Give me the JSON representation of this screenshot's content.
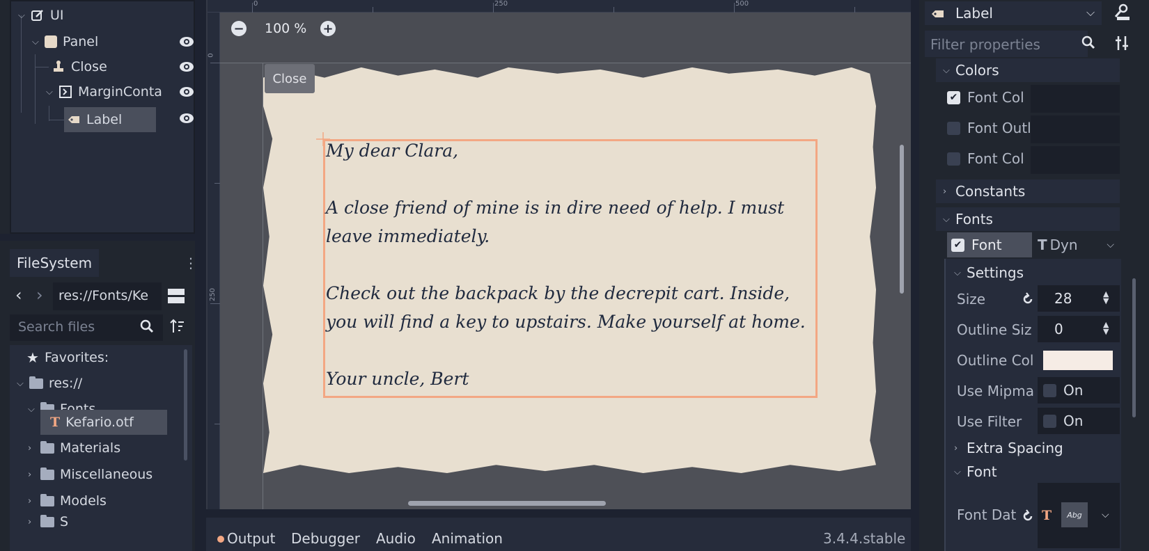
{
  "scene": {
    "root": "UI",
    "nodes": [
      {
        "name": "Panel"
      },
      {
        "name": "Close"
      },
      {
        "name": "MarginConta"
      },
      {
        "name": "Label"
      }
    ]
  },
  "filesystem": {
    "tab": "FileSystem",
    "path": "res://Fonts/Ke",
    "search_placeholder": "Search files",
    "favorites": "Favorites:",
    "items": [
      {
        "label": "res://"
      },
      {
        "label": "Fonts"
      },
      {
        "label": "Kefario.otf"
      },
      {
        "label": "Materials"
      },
      {
        "label": "Miscellaneous"
      },
      {
        "label": "Models"
      },
      {
        "label": "S"
      }
    ]
  },
  "viewport": {
    "zoom": "100 %",
    "ruler_top": [
      "0",
      "250",
      "500"
    ],
    "ruler_left": [
      "0",
      "250"
    ],
    "close_button": "Close",
    "letter_text": "My dear Clara,\n\nA close friend of mine is in dire need of help. I must\nleave immediately.\n\nCheck out the backpack by the decrepit cart. Inside,\nyou will find a key to upstairs. Make yourself at home.\n\nYour uncle, Bert"
  },
  "bottom": {
    "tabs": [
      "Output",
      "Debugger",
      "Audio",
      "Animation"
    ],
    "version": "3.4.4.stable"
  },
  "inspector": {
    "class_name": "Label",
    "filter_placeholder": "Filter properties",
    "colors_section": "Colors",
    "colors": [
      {
        "label": "Font Col",
        "checked": true
      },
      {
        "label": "Font Outl",
        "checked": false
      },
      {
        "label": "Font Col",
        "checked": false
      }
    ],
    "constants_section": "Constants",
    "fonts_section": "Fonts",
    "font_prop": "Font",
    "font_type": "Dyn",
    "settings_section": "Settings",
    "size_label": "Size",
    "size_value": "28",
    "outline_size_label": "Outline Siz",
    "outline_size_value": "0",
    "outline_color_label": "Outline Col",
    "outline_color": "#f6ece5",
    "use_mipmaps_label": "Use Mipma",
    "use_mipmaps_value": "On",
    "use_filter_label": "Use Filter",
    "use_filter_value": "On",
    "extra_spacing_section": "Extra Spacing",
    "font_section": "Font",
    "font_data_label": "Font Dat",
    "font_preview": "Abg"
  },
  "colors": {
    "accent": "#f3a783",
    "panel": "#262c3b",
    "paper": "#e8dfd0"
  }
}
